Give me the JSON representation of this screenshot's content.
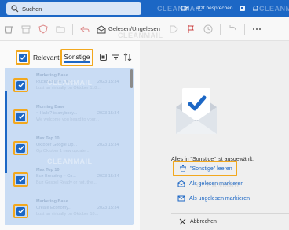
{
  "titlebar": {
    "search_placeholder": "Suchen",
    "meet_now_label": "Jetzt besprechen",
    "accent": "#1c67c5"
  },
  "toolbar": {
    "read_unread_label": "Gelesen/Ungelesen"
  },
  "list": {
    "tab_relevant": "Relevant",
    "tab_other": "Sonstige",
    "rows": [
      {
        "sender": "Marketing Base",
        "subject": "Rückzahlung 7 jet...",
        "date": "2023 15:34",
        "preview": "Lust an virtually on Oktober 118..."
      },
      {
        "sender": "Morning Base",
        "subject": "~ Hallo? is anybody...",
        "date": "2023 15:34",
        "preview": "We welcome you heard to your..."
      },
      {
        "sender": "Max Top 10",
        "subject": "Oktober Google Up...",
        "date": "2023 15:34",
        "preview": "Op Oktober 1 new update..."
      },
      {
        "sender": "Max Top 10",
        "subject": "Buz Breading ~ Co...",
        "date": "2023 15:34",
        "preview": "Buz Gospel Ready or not, the..."
      },
      {
        "sender": "Marketing Base",
        "subject": "Create Economy...",
        "date": "2023 15:34",
        "preview": "Lust an virtually on Oktober 18..."
      }
    ]
  },
  "reading_pane": {
    "selected_info": "Alles in \"Sonstige\" ist ausgewählt.",
    "empty_button": "\"Sonstige\" leeren",
    "mark_read": "Als gelesen markieren",
    "mark_unread": "Als ungelesen markieren",
    "cancel": "Abbrechen"
  },
  "watermark": "CLEANMAIL",
  "colors": {
    "highlight": "#f2a81e",
    "selection": "#c9dcf4",
    "link": "#1c67c5"
  }
}
